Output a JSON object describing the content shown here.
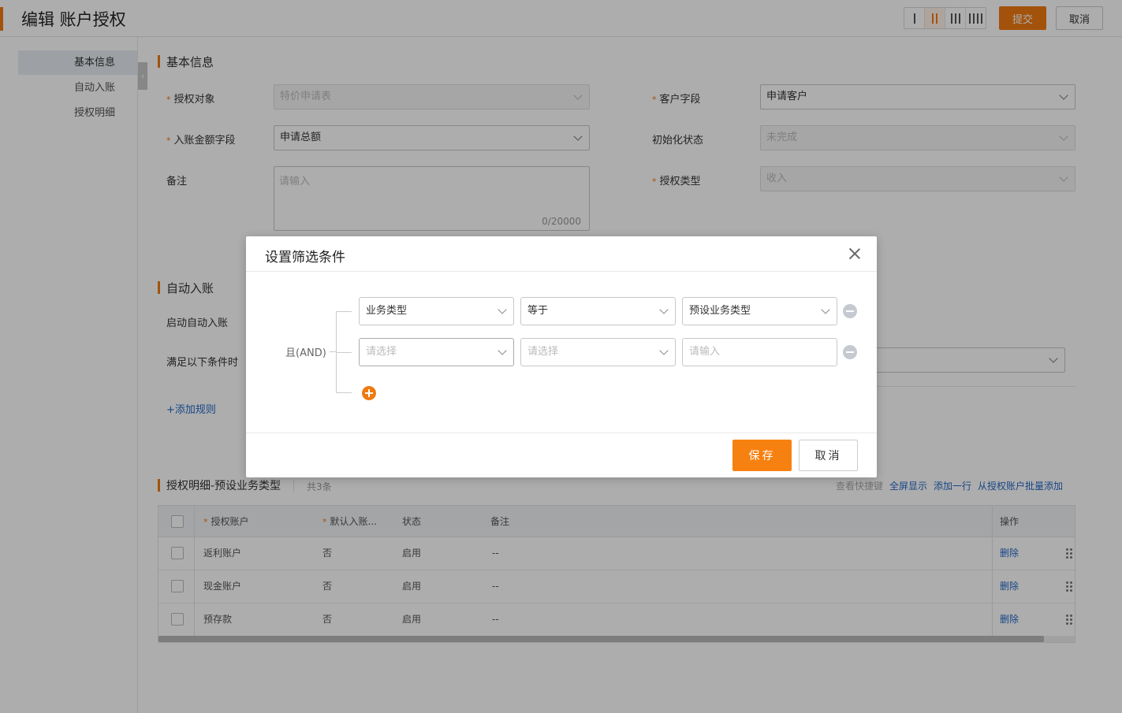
{
  "header": {
    "title": "编辑 账户授权",
    "submit_label": "提交",
    "cancel_label": "取消"
  },
  "leftnav": {
    "items": [
      {
        "label": "基本信息",
        "active": true
      },
      {
        "label": "自动入账",
        "active": false
      },
      {
        "label": "授权明细",
        "active": false
      }
    ]
  },
  "basic": {
    "title": "基本信息",
    "auth_object_label": "授权对象",
    "auth_object_value": "特价申请表",
    "customer_field_label": "客户字段",
    "customer_field_value": "申请客户",
    "amount_field_label": "入账金额字段",
    "amount_field_value": "申请总额",
    "init_status_label": "初始化状态",
    "init_status_value": "未完成",
    "remark_label": "备注",
    "remark_placeholder": "请输入",
    "remark_count": "0/20000",
    "auth_type_label": "授权类型",
    "auth_type_value": "收入"
  },
  "auto": {
    "title": "自动入账",
    "enable_label": "启动自动入账",
    "condition_label": "满足以下条件时",
    "add_rule": "+添加规则"
  },
  "detail": {
    "title": "授权明细-预设业务类型",
    "count": "共3条",
    "shortcut": "查看快捷键",
    "fullscreen": "全屏显示",
    "add_row": "添加一行",
    "batch_add": "从授权账户批量添加",
    "columns": [
      "授权账户",
      "默认入账...",
      "状态",
      "备注",
      "操作"
    ],
    "rows": [
      {
        "account": "返利账户",
        "default": "否",
        "status": "启用",
        "remark": "--",
        "action": "删除"
      },
      {
        "account": "现金账户",
        "default": "否",
        "status": "启用",
        "remark": "--",
        "action": "删除"
      },
      {
        "account": "预存款",
        "default": "否",
        "status": "启用",
        "remark": "--",
        "action": "删除"
      }
    ]
  },
  "modal": {
    "title": "设置筛选条件",
    "logic_label": "且(AND)",
    "conditions": [
      {
        "field": "业务类型",
        "op": "等于",
        "value": "预设业务类型"
      },
      {
        "field": "请选择",
        "op": "请选择",
        "value": "请输入"
      }
    ],
    "save_label": "保存",
    "cancel_label": "取消"
  },
  "colors": {
    "accent": "#f07a12",
    "link": "#2468c7"
  }
}
